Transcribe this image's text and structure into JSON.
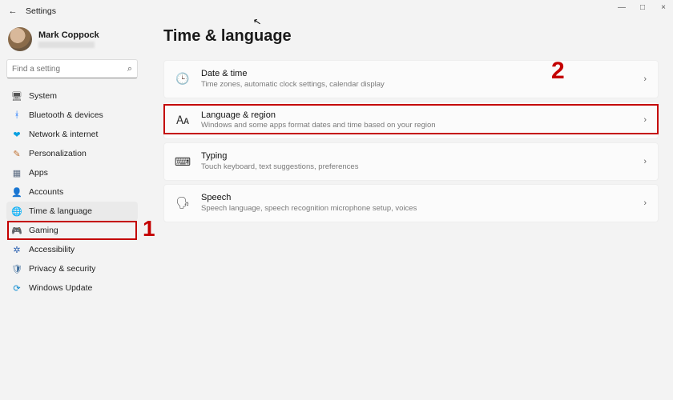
{
  "app_title": "Settings",
  "window_controls": {
    "min": "—",
    "max": "□",
    "close": "×"
  },
  "profile": {
    "name": "Mark Coppock"
  },
  "search": {
    "placeholder": "Find a setting"
  },
  "sidebar": {
    "items": [
      {
        "label": "System",
        "icon": "🖥",
        "cls": "ic-system"
      },
      {
        "label": "Bluetooth & devices",
        "icon": "ᚼ",
        "cls": "ic-bt"
      },
      {
        "label": "Network & internet",
        "icon": "❤",
        "cls": "ic-net"
      },
      {
        "label": "Personalization",
        "icon": "✎",
        "cls": "ic-pers"
      },
      {
        "label": "Apps",
        "icon": "▦",
        "cls": "ic-apps"
      },
      {
        "label": "Accounts",
        "icon": "👤",
        "cls": "ic-acc"
      },
      {
        "label": "Time & language",
        "icon": "🌐",
        "cls": "ic-time",
        "active": true
      },
      {
        "label": "Gaming",
        "icon": "🎮",
        "cls": "ic-game"
      },
      {
        "label": "Accessibility",
        "icon": "✲",
        "cls": "ic-access"
      },
      {
        "label": "Privacy & security",
        "icon": "🛡",
        "cls": "ic-priv"
      },
      {
        "label": "Windows Update",
        "icon": "⟳",
        "cls": "ic-wu"
      }
    ]
  },
  "page": {
    "title": "Time & language",
    "cards": [
      {
        "icon": "🕒",
        "title": "Date & time",
        "sub": "Time zones, automatic clock settings, calendar display"
      },
      {
        "icon": "🗛",
        "title": "Language & region",
        "sub": "Windows and some apps format dates and time based on your region"
      },
      {
        "icon": "⌨",
        "title": "Typing",
        "sub": "Touch keyboard, text suggestions, preferences"
      },
      {
        "icon": "🗣",
        "title": "Speech",
        "sub": "Speech language, speech recognition microphone setup, voices"
      }
    ]
  },
  "annotations": {
    "marker1": "1",
    "marker2": "2"
  }
}
